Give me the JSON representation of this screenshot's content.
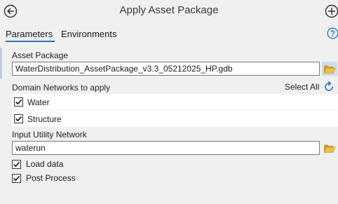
{
  "header": {
    "title": "Apply Asset Package",
    "back_icon": "arrow-left-circle-icon",
    "add_icon": "plus-circle-icon"
  },
  "tabs": [
    {
      "label": "Parameters",
      "active": true
    },
    {
      "label": "Environments",
      "active": false
    }
  ],
  "help_icon": "question-circle-icon",
  "asset_package": {
    "label": "Asset Package",
    "value": "WaterDistribution_AssetPackage_v3.3_05212025_HP.gdb",
    "browse_icon": "folder-open-icon"
  },
  "domain_networks": {
    "label": "Domain Networks to apply",
    "select_all_label": "Select All",
    "refresh_icon": "refresh-icon",
    "items": [
      {
        "label": "Water",
        "checked": true
      },
      {
        "label": "Structure",
        "checked": true
      }
    ]
  },
  "utility_network": {
    "label": "Input Utility Network",
    "value": "waterun",
    "browse_icon": "folder-open-icon"
  },
  "options": [
    {
      "label": "Load data",
      "checked": true
    },
    {
      "label": "Post Process",
      "checked": true
    }
  ],
  "colors": {
    "accent": "#2d6fb5",
    "background": "#f0f0f0",
    "folder": "#e8c04a"
  }
}
